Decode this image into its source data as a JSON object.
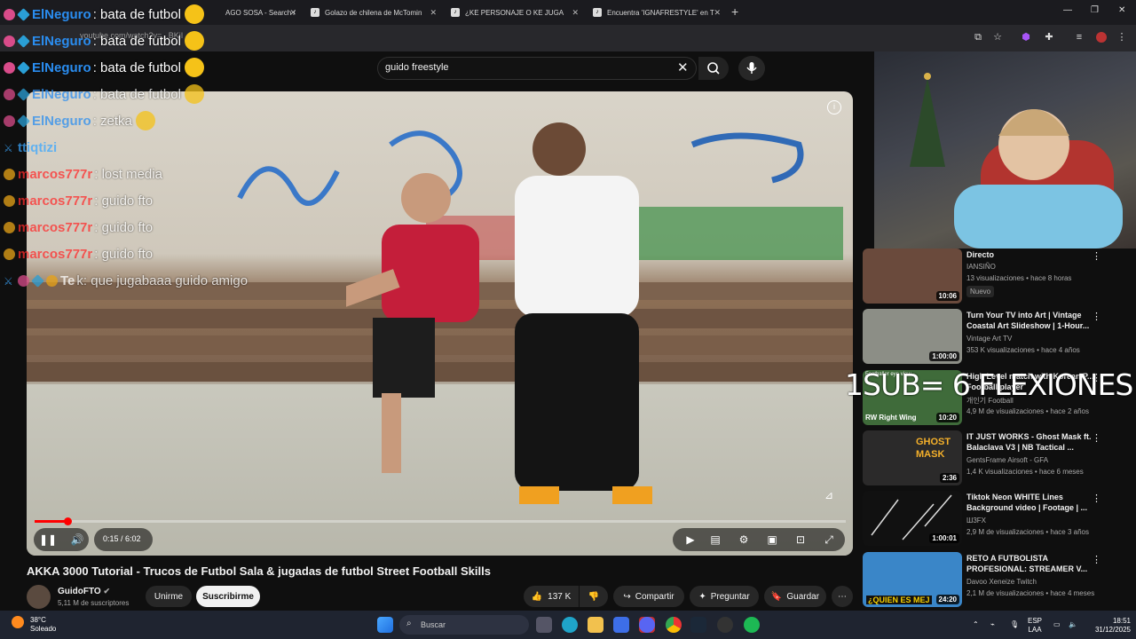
{
  "browser": {
    "tabs": [
      {
        "label": "AGO SOSA - Search /"
      },
      {
        "label": "Golazo de chilena de McTomin"
      },
      {
        "label": "¿KE PERSONAJE O KE JUGA"
      },
      {
        "label": "Encuentra 'IGNAFRESTYLE' en T"
      }
    ],
    "url": "youtube.com/watch?v=...BKjI"
  },
  "search": {
    "query": "guido freestyle"
  },
  "player": {
    "time": "0:15 / 6:02",
    "progress": 0.04
  },
  "video": {
    "title": "AKKA 3000 Tutorial - Trucos de Futbol Sala & jugadas de futbol Street Football Skills",
    "channel": "GuidoFTO",
    "subscribers": "5,11 M de suscriptores",
    "join_label": "Unirme",
    "subscribe_label": "Suscribirme",
    "likes": "137 K",
    "share_label": "Compartir",
    "ask_label": "Preguntar",
    "save_label": "Guardar"
  },
  "overlay": {
    "text": "1SUB= 6 FLEXIONES"
  },
  "sidebar": {
    "items": [
      {
        "title": "Directo",
        "channel": "IANSIÑO",
        "meta": "13 visualizaciones • hace 8 horas",
        "badge": "Nuevo",
        "duration": "10:06",
        "thumb": "#6a4a3c"
      },
      {
        "title": "Turn Your TV into Art | Vintage Coastal Art Slideshow | 1-Hour...",
        "channel": "Vintage Art TV",
        "meta": "353 K visualizaciones • hace 4 años",
        "duration": "1:00:00",
        "thumb": "#8c8e86"
      },
      {
        "title": "High Level match with Korean P... Football player",
        "channel": "개인기 Football",
        "meta": "4,9 M de visualizaciones • hace 2 años",
        "duration": "10:20",
        "thumb": "#3f6b3a",
        "thumb_label": "RW  Right Wing",
        "thumb_top": "Footballer eye view"
      },
      {
        "title": "IT JUST WORKS - Ghost Mask ft. Balaclava V3 | NB Tactical ...",
        "channel": "GentsFrame Airsoft - GFA",
        "meta": "1,4 K visualizaciones • hace 6 meses",
        "duration": "2:36",
        "thumb": "#2b2a2a",
        "thumb_label": "GHOST MASK"
      },
      {
        "title": "Tiktok Neon WHITE Lines Background video | Footage | ...",
        "channel": "Ш3FX",
        "meta": "2,9 M de visualizaciones • hace 3 años",
        "duration": "1:00:01",
        "thumb": "#111111"
      },
      {
        "title": "RETO A FUTBOLISTA PROFESIONAL: STREAMER V...",
        "channel": "Davoo Xeneize Twitch",
        "meta": "2,1 M de visualizaciones • hace 4 meses",
        "duration": "24:20",
        "thumb": "#3a86c8",
        "thumb_label": "¿QUIEN ES MEJ"
      }
    ]
  },
  "chat": [
    {
      "badges": [
        "pink",
        "blue"
      ],
      "user": "ElNeguro",
      "user_color": "#2a8df0",
      "msg": ": bata de futbol",
      "emoji": true,
      "faded": false
    },
    {
      "badges": [
        "pink",
        "blue"
      ],
      "user": "ElNeguro",
      "user_color": "#2a8df0",
      "msg": ": bata de futbol",
      "emoji": true,
      "faded": false
    },
    {
      "badges": [
        "pink",
        "blue"
      ],
      "user": "ElNeguro",
      "user_color": "#2a8df0",
      "msg": ": bata de futbol",
      "emoji": true,
      "faded": false
    },
    {
      "badges": [
        "pink",
        "blue"
      ],
      "user": "ElNeguro",
      "user_color": "#2a8df0",
      "msg": ": bata de futbol",
      "emoji": true,
      "faded": true
    },
    {
      "badges": [
        "pink",
        "blue"
      ],
      "user": "ElNeguro",
      "user_color": "#2a8df0",
      "msg": ": zetka",
      "emoji": true,
      "faded": true
    },
    {
      "badges": [
        "sword"
      ],
      "user": "ttiqtizi",
      "user_color": "#3aa7ff",
      "msg": "",
      "emoji": false,
      "faded": true
    },
    {
      "badges": [
        "gold"
      ],
      "user": "marcos777r",
      "user_color": "#ff2b2b",
      "msg": ": lost media",
      "emoji": false,
      "faded": true
    },
    {
      "badges": [
        "gold"
      ],
      "user": "marcos777r",
      "user_color": "#ff2b2b",
      "msg": ": guido fto",
      "emoji": false,
      "faded": true
    },
    {
      "badges": [
        "gold"
      ],
      "user": "marcos777r",
      "user_color": "#ff2b2b",
      "msg": ": guido fto",
      "emoji": false,
      "faded": true
    },
    {
      "badges": [
        "gold"
      ],
      "user": "marcos777r",
      "user_color": "#ff2b2b",
      "msg": ": guido fto",
      "emoji": false,
      "faded": true
    },
    {
      "badges": [
        "sword",
        "pink",
        "blue",
        "gold"
      ],
      "user": "Te",
      "user_color": "#ffffff",
      "msg": "k: que jugabaaa guido amigo",
      "emoji": false,
      "faded": true
    }
  ],
  "taskbar": {
    "temp": "38°C",
    "weather": "Soleado",
    "search_placeholder": "Buscar",
    "lang_top": "ESP",
    "lang_bottom": "LAA",
    "time": "18:51",
    "date": "31/12/2025"
  },
  "colors": {
    "accent_red": "#ff0000",
    "background": "#0f0f0f"
  }
}
